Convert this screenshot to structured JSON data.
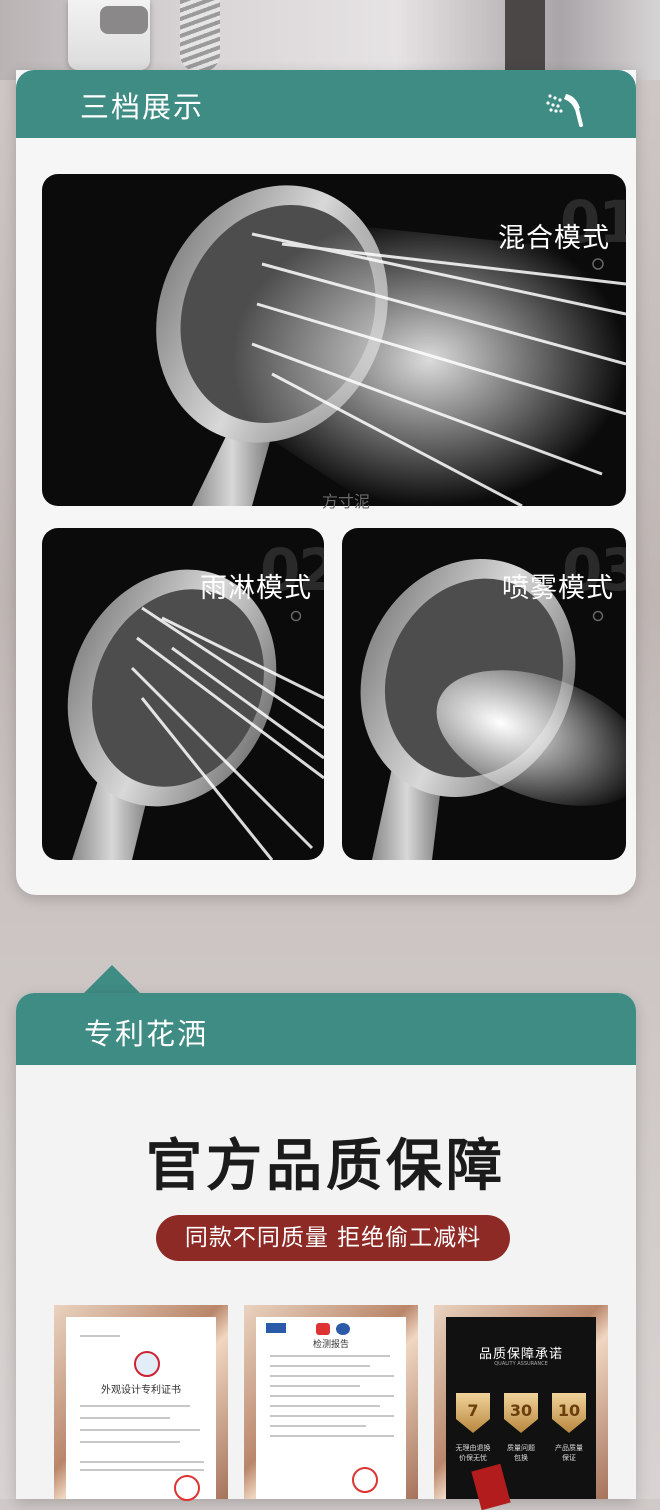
{
  "section1": {
    "title": "三档展示",
    "modes": [
      {
        "num": "01",
        "label": "混合模式"
      },
      {
        "num": "02",
        "label": "雨淋模式"
      },
      {
        "num": "03",
        "label": "喷雾模式"
      }
    ],
    "watermark": "方寸泥"
  },
  "section2": {
    "title": "专利花洒",
    "headline": "官方品质保障",
    "pill": "同款不同质量  拒绝偷工减料",
    "cert1_title": "外观设计专利证书",
    "cert2_title": "检测报告",
    "cert3": {
      "title": "品质保障承诺",
      "subtitle": "QUALITY ASSURANCE",
      "badges": [
        {
          "num": "7",
          "text": "无理由退换\n价保无忧"
        },
        {
          "num": "30",
          "text": "质量问题\n包换"
        },
        {
          "num": "10",
          "text": "产品质量\n保证"
        }
      ]
    }
  },
  "colors": {
    "teal": "#3f8c84",
    "maroon": "#8e2a26"
  }
}
